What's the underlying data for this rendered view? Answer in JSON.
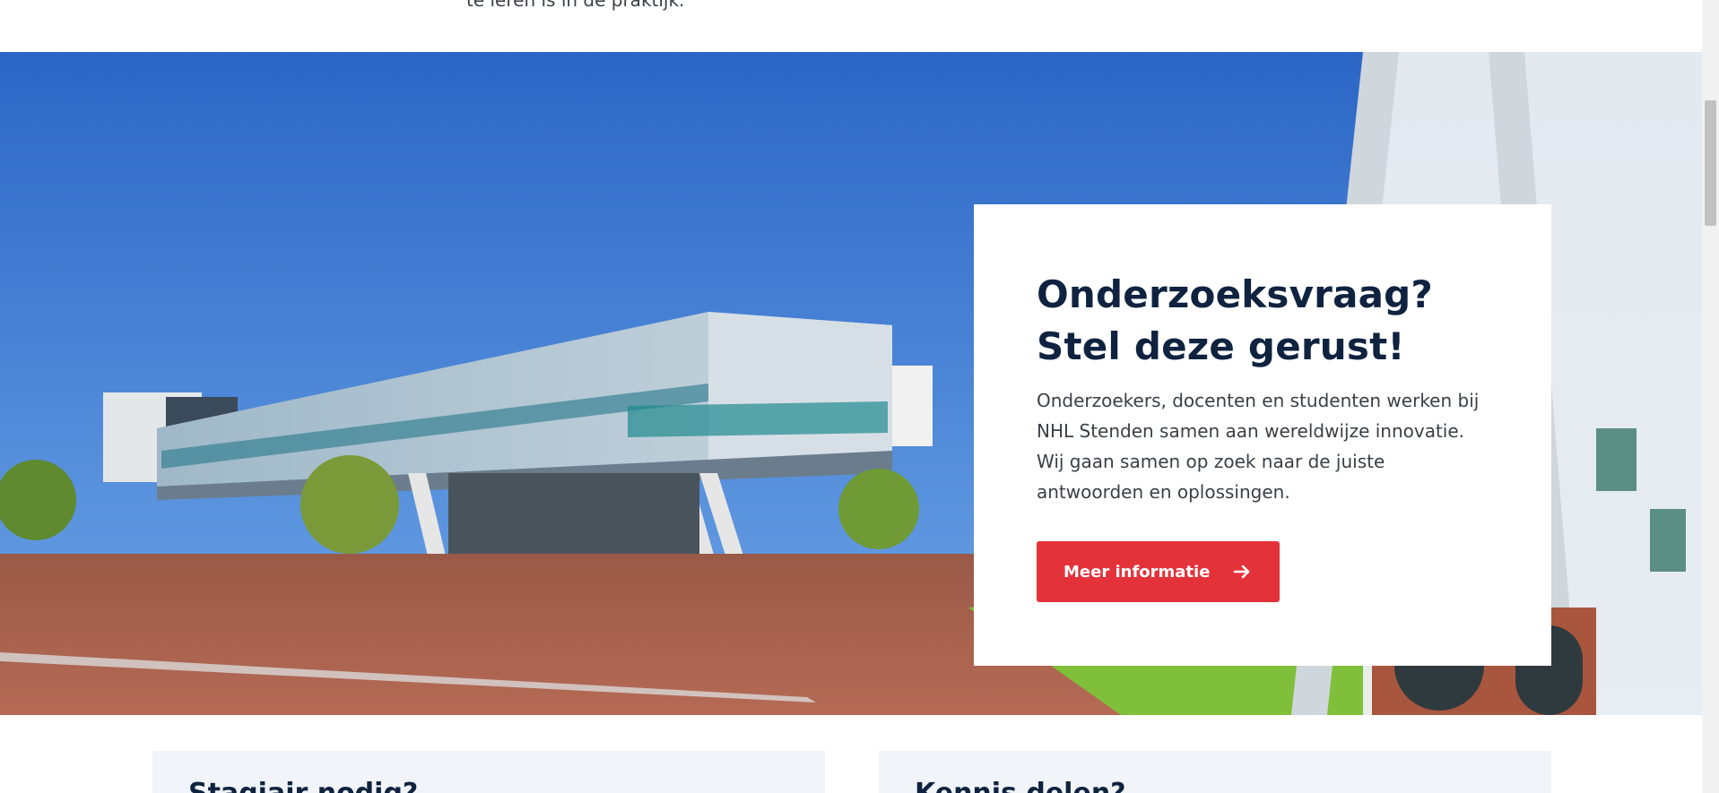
{
  "intro": {
    "tail_text": "te leren is in de praktijk."
  },
  "hero": {
    "image_label": "Campus building photo"
  },
  "cta": {
    "title": "Onderzoeksvraag? Stel deze gerust!",
    "body": "Onderzoekers, docenten en studenten werken bij NHL Stenden samen aan wereldwijze innovatie. Wij gaan samen op zoek naar de juiste antwoorden en oplossingen.",
    "button_label": "Meer informatie",
    "button_icon": "arrow-right-icon"
  },
  "cards": [
    {
      "title": "Stagiair nodig?"
    },
    {
      "title": "Kennis delen?"
    }
  ],
  "colors": {
    "accent": "#e3323a",
    "heading": "#0f2340",
    "card_bg": "#f1f5f9"
  }
}
